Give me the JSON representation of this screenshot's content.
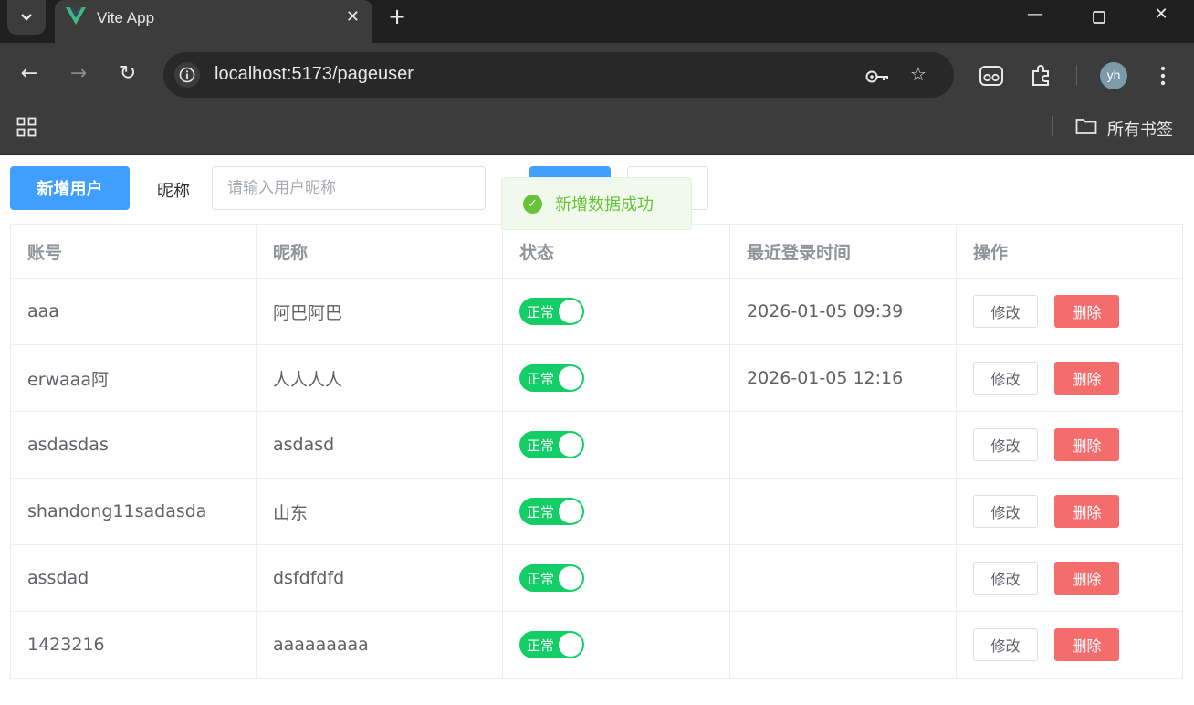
{
  "browser": {
    "tab_title": "Vite App",
    "url": "localhost:5173/pageuser",
    "avatar_initials": "yh",
    "bookmarks_label": "所有书签"
  },
  "page": {
    "add_user_label": "新增用户",
    "nickname_filter_label": "昵称",
    "nickname_placeholder": "请输入用户昵称",
    "toast_message": "新增数据成功",
    "accent_color": "#409eff",
    "success_color": "#67c23a",
    "danger_color": "#f56c6c",
    "switch_on_color": "#13ce66"
  },
  "table": {
    "headers": [
      "账号",
      "昵称",
      "状态",
      "最近登录时间",
      "操作"
    ],
    "status_label": "正常",
    "edit_label": "修改",
    "delete_label": "删除",
    "rows": [
      {
        "account": "aaa",
        "nickname": "阿巴阿巴",
        "status_on": true,
        "last_login": "2026-01-05 09:39"
      },
      {
        "account": "erwaaa阿",
        "nickname": "人人人人",
        "status_on": true,
        "last_login": "2026-01-05 12:16"
      },
      {
        "account": "asdasdas",
        "nickname": "asdasd",
        "status_on": true,
        "last_login": ""
      },
      {
        "account": "shandong11sadasda",
        "nickname": "山东",
        "status_on": true,
        "last_login": ""
      },
      {
        "account": "assdad",
        "nickname": "dsfdfdfd",
        "status_on": true,
        "last_login": ""
      },
      {
        "account": "1423216",
        "nickname": "aaaaaaaaa",
        "status_on": true,
        "last_login": ""
      }
    ]
  }
}
